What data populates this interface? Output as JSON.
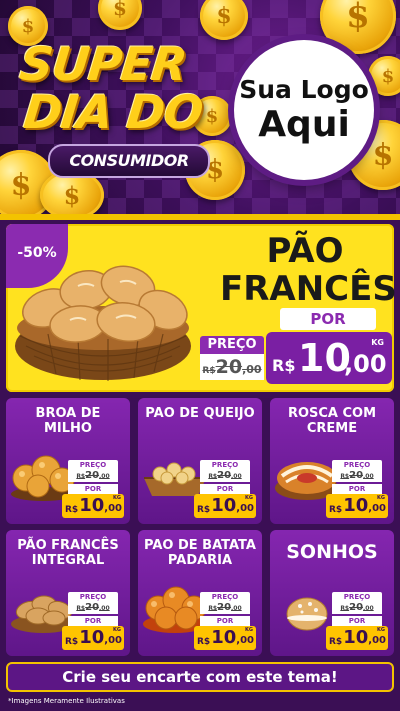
{
  "header": {
    "title_line1": "SUPER",
    "title_line2": "DIA DO",
    "subtitle": "CONSUMIDOR",
    "logo_line1": "Sua Logo",
    "logo_line2": "Aqui",
    "coin_symbol": "$"
  },
  "featured": {
    "discount": "-50%",
    "name_line1": "PÃO",
    "name_line2": "FRANCÊS",
    "por_label": "POR",
    "preco_label": "PREÇO",
    "old_currency": "R$",
    "old_int": "20",
    "old_dec": ",00",
    "new_currency": "R$",
    "new_int": "10",
    "new_dec": ",00",
    "unit": "KG"
  },
  "products": [
    {
      "name": "BROA DE MILHO",
      "preco_label": "PREÇO",
      "old_currency": "R$",
      "old_int": "20",
      "old_dec": ",00",
      "por_label": "POR",
      "new_currency": "R$",
      "new_int": "10",
      "new_dec": ",00",
      "unit": "KG"
    },
    {
      "name": "PAO DE QUEIJO",
      "preco_label": "PREÇO",
      "old_currency": "R$",
      "old_int": "20",
      "old_dec": ",00",
      "por_label": "POR",
      "new_currency": "R$",
      "new_int": "10",
      "new_dec": ",00",
      "unit": "KG"
    },
    {
      "name": "ROSCA COM CREME",
      "preco_label": "PREÇO",
      "old_currency": "R$",
      "old_int": "20",
      "old_dec": ",00",
      "por_label": "POR",
      "new_currency": "R$",
      "new_int": "10",
      "new_dec": ",00",
      "unit": "KG"
    },
    {
      "name": "PÃO FRANCÊS INTEGRAL",
      "preco_label": "PREÇO",
      "old_currency": "R$",
      "old_int": "20",
      "old_dec": ",00",
      "por_label": "POR",
      "new_currency": "R$",
      "new_int": "10",
      "new_dec": ",00",
      "unit": "KG"
    },
    {
      "name": "PAO DE BATATA PADARIA",
      "preco_label": "PREÇO",
      "old_currency": "R$",
      "old_int": "20",
      "old_dec": ",00",
      "por_label": "POR",
      "new_currency": "R$",
      "new_int": "10",
      "new_dec": ",00",
      "unit": "KG"
    },
    {
      "name": "SONHOS",
      "preco_label": "PREÇO",
      "old_currency": "R$",
      "old_int": "20",
      "old_dec": ",00",
      "por_label": "POR",
      "new_currency": "R$",
      "new_int": "10",
      "new_dec": ",00",
      "unit": "KG"
    }
  ],
  "footer": {
    "cta": "Crie seu encarte com este tema!",
    "disclaimer": "*Imagens Meramente Ilustrativas"
  },
  "colors": {
    "purple": "#8b2bb0",
    "yellow": "#ffe21f",
    "gold": "#f3c300",
    "dark_purple": "#3b0f55"
  }
}
